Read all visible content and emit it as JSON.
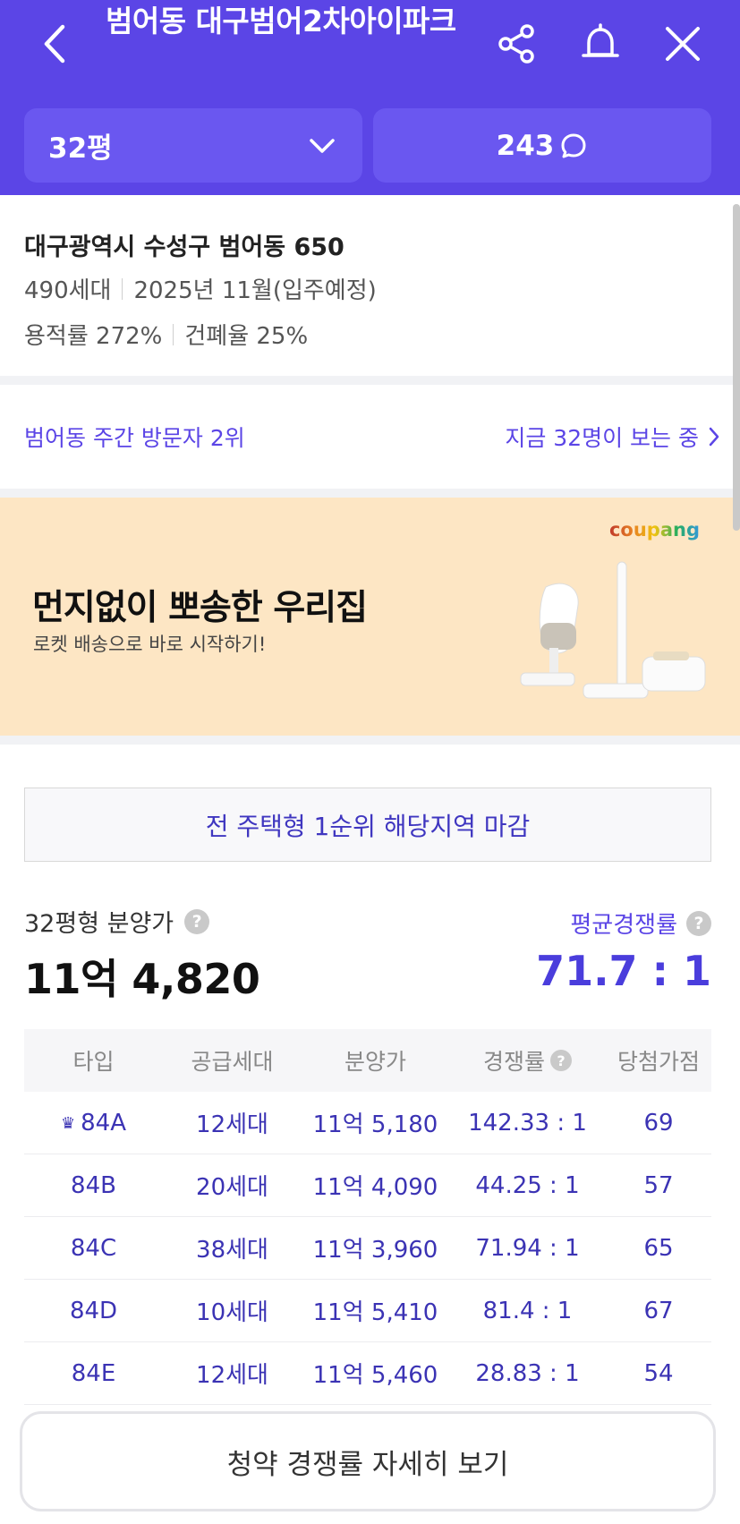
{
  "header": {
    "title": "범어동 대구범어2차아이파크",
    "size_select": "32평",
    "comments_count": "243"
  },
  "info": {
    "address": "대구광역시 수성구 범어동 650",
    "households": "490세대",
    "move_in": "2025년 11월(입주예정)",
    "far": "용적률 272%",
    "bcr": "건폐율 25%"
  },
  "visitors": {
    "rank_text": "범어동 주간 방문자 2위",
    "viewing_now": "지금 32명이 보는 중"
  },
  "ad": {
    "brand": "coupang",
    "title": "먼지없이 뽀송한 우리집",
    "subtitle": "로켓 배송으로 바로 시작하기!"
  },
  "notice": "전 주택형 1순위 해당지역 마감",
  "price": {
    "label": "32평형 분양가",
    "value": "11억 4,820",
    "ratio_label": "평균경쟁률",
    "ratio_value": "71.7 : 1"
  },
  "table": {
    "headers": [
      "타입",
      "공급세대",
      "분양가",
      "경쟁률",
      "당첨가점"
    ],
    "rows": [
      {
        "type": "84A",
        "supply": "12세대",
        "price": "11억 5,180",
        "ratio": "142.33 : 1",
        "score": "69"
      },
      {
        "type": "84B",
        "supply": "20세대",
        "price": "11억 4,090",
        "ratio": "44.25 : 1",
        "score": "57"
      },
      {
        "type": "84C",
        "supply": "38세대",
        "price": "11억 3,960",
        "ratio": "71.94 : 1",
        "score": "65"
      },
      {
        "type": "84D",
        "supply": "10세대",
        "price": "11억 5,410",
        "ratio": "81.4 : 1",
        "score": "67"
      },
      {
        "type": "84E",
        "supply": "12세대",
        "price": "11억 5,460",
        "ratio": "28.83 : 1",
        "score": "54"
      }
    ]
  },
  "detail_button": "청약 경쟁률 자세히 보기",
  "colors": {
    "primary": "#5b45e6",
    "accent_text": "#3b33b4",
    "banner_bg": "#fde6c4"
  }
}
